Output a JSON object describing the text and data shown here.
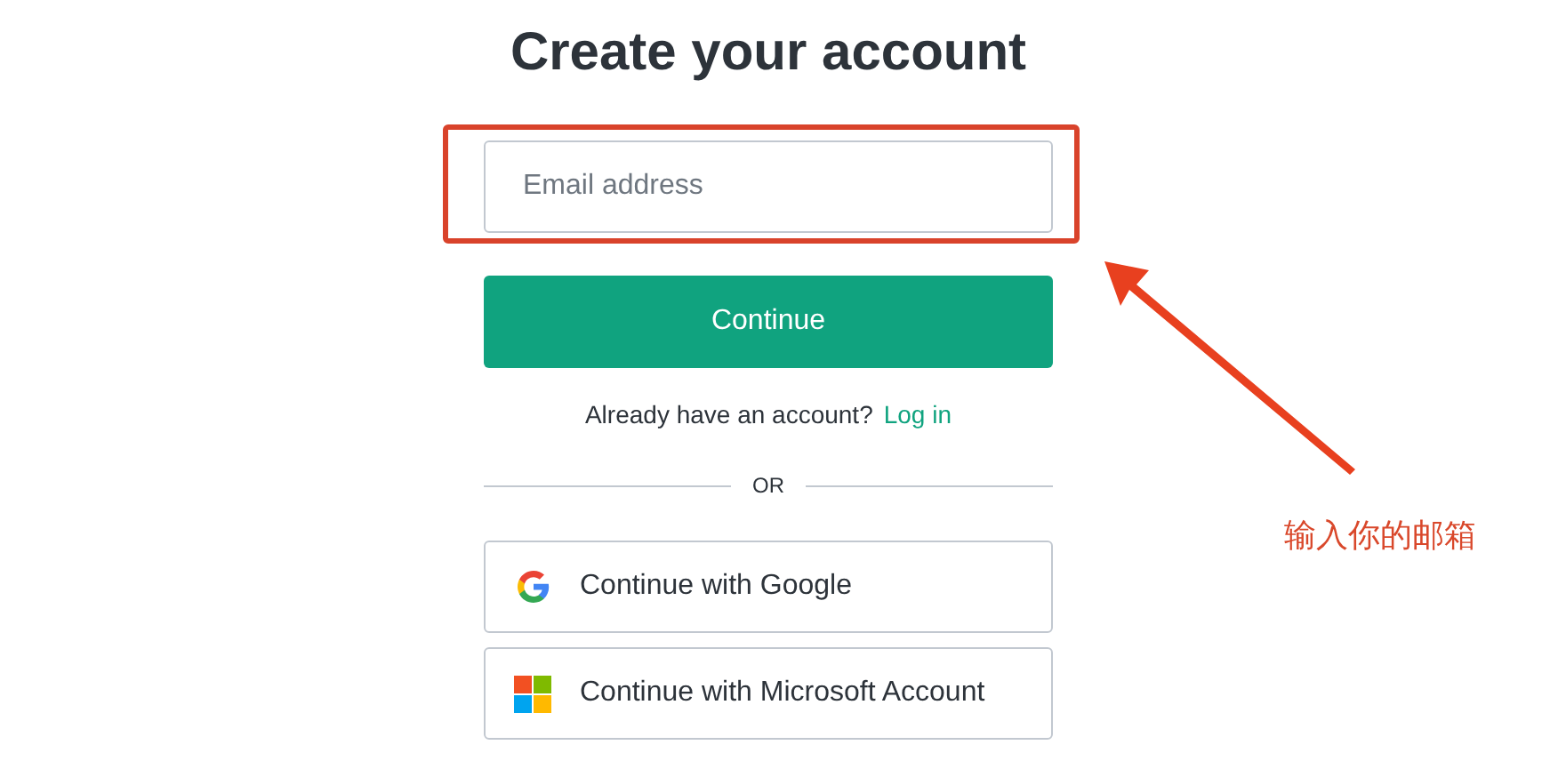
{
  "title": "Create your account",
  "email_field": {
    "placeholder": "Email address"
  },
  "continue_button": "Continue",
  "login_prompt": {
    "text": "Already have an account?",
    "link": "Log in"
  },
  "divider": "OR",
  "providers": [
    {
      "kind": "google",
      "label": "Continue with Google"
    },
    {
      "kind": "microsoft",
      "label": "Continue with Microsoft Account"
    }
  ],
  "annotation": {
    "note": "输入你的邮箱"
  }
}
